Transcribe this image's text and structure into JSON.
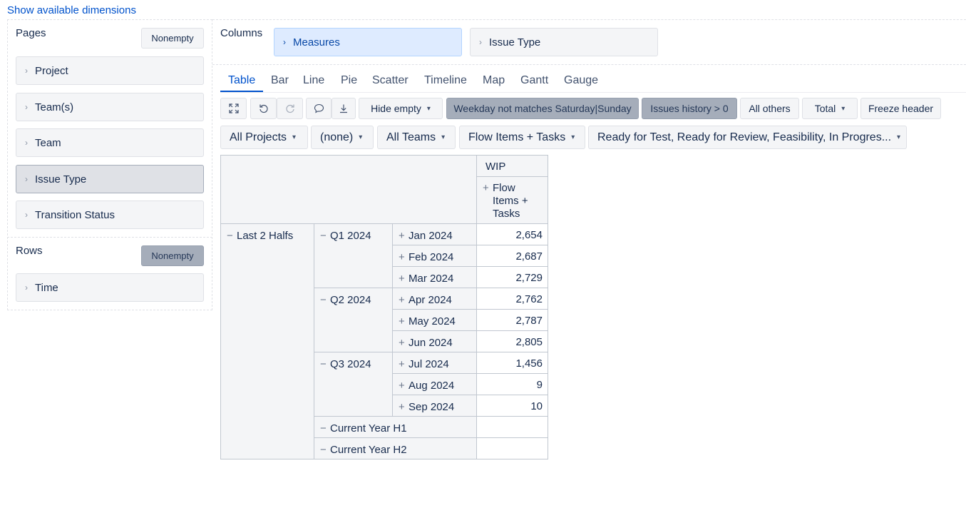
{
  "header": {
    "show_dimensions_link": "Show available dimensions"
  },
  "pages": {
    "title": "Pages",
    "nonempty_label": "Nonempty",
    "items": [
      "Project",
      "Team(s)",
      "Team",
      "Issue Type",
      "Transition Status"
    ]
  },
  "rows": {
    "title": "Rows",
    "nonempty_label": "Nonempty",
    "items": [
      "Time"
    ]
  },
  "columns": {
    "title": "Columns",
    "items": [
      "Measures",
      "Issue Type"
    ]
  },
  "tabs": [
    "Table",
    "Bar",
    "Line",
    "Pie",
    "Scatter",
    "Timeline",
    "Map",
    "Gantt",
    "Gauge"
  ],
  "toolbar": {
    "hide_empty": "Hide empty",
    "weekday_filter": "Weekday not matches Saturday|Sunday",
    "issues_history": "Issues history > 0",
    "all_others": "All others",
    "total": "Total",
    "freeze_header": "Freeze header"
  },
  "filters": [
    "All Projects",
    "(none)",
    "All Teams",
    "Flow Items + Tasks",
    "Ready for Test, Ready for Review, Feasibility, In Progres..."
  ],
  "table": {
    "measure_header": "WIP",
    "issue_type_header": "Flow Items + Tasks",
    "level1": "Last 2 Halfs",
    "quarters": [
      {
        "label": "Q1 2024",
        "months": [
          {
            "label": "Jan 2024",
            "value": "2,654"
          },
          {
            "label": "Feb 2024",
            "value": "2,687"
          },
          {
            "label": "Mar 2024",
            "value": "2,729"
          }
        ]
      },
      {
        "label": "Q2 2024",
        "months": [
          {
            "label": "Apr 2024",
            "value": "2,762"
          },
          {
            "label": "May 2024",
            "value": "2,787"
          },
          {
            "label": "Jun 2024",
            "value": "2,805"
          }
        ]
      },
      {
        "label": "Q3 2024",
        "months": [
          {
            "label": "Jul 2024",
            "value": "1,456"
          },
          {
            "label": "Aug 2024",
            "value": "9"
          },
          {
            "label": "Sep 2024",
            "value": "10"
          }
        ]
      }
    ],
    "halves": [
      "Current Year H1",
      "Current Year H2"
    ]
  }
}
